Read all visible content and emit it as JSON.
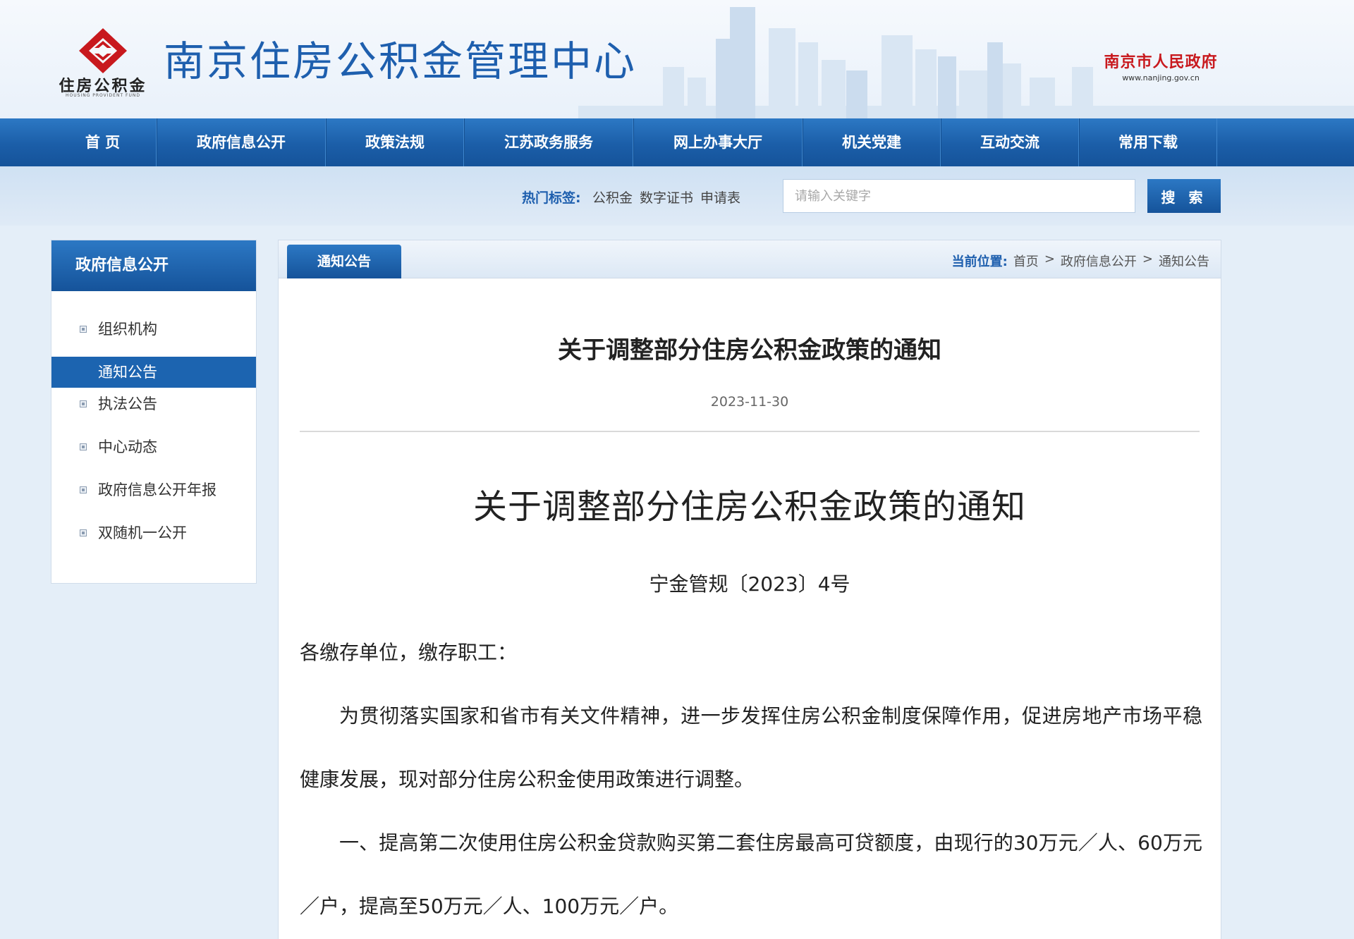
{
  "header": {
    "logo_cn": "住房公积金",
    "logo_en": "HOUSING PROVIDENT FUND",
    "site_title": "南京住房公积金管理中心",
    "gov_cn": "南京市人民政府",
    "gov_en": "www.nanjing.gov.cn",
    "colors": {
      "brand_blue": "#1e5fae",
      "logo_red": "#c8191e"
    }
  },
  "nav": {
    "items": [
      {
        "label": "首 页"
      },
      {
        "label": "政府信息公开"
      },
      {
        "label": "政策法规"
      },
      {
        "label": "江苏政务服务"
      },
      {
        "label": "网上办事大厅"
      },
      {
        "label": "机关党建"
      },
      {
        "label": "互动交流"
      },
      {
        "label": "常用下载"
      }
    ]
  },
  "search": {
    "hot_label": "热门标签:",
    "tags": [
      "公积金",
      "数字证书",
      "申请表"
    ],
    "placeholder": "请输入关键字",
    "button": "搜 索"
  },
  "sidebar": {
    "title": "政府信息公开",
    "items": [
      {
        "label": "组织机构"
      },
      {
        "label": "通知公告"
      },
      {
        "label": "执法公告"
      },
      {
        "label": "中心动态"
      },
      {
        "label": "政府信息公开年报"
      },
      {
        "label": "双随机一公开"
      }
    ],
    "active_index": 1
  },
  "main": {
    "tab": "通知公告",
    "breadcrumb": {
      "label": "当前位置:",
      "items": [
        "首页",
        "政府信息公开",
        "通知公告"
      ],
      "separator": ">"
    },
    "article": {
      "title": "关于调整部分住房公积金政策的通知",
      "date": "2023-11-30",
      "doc_title": "关于调整部分住房公积金政策的通知",
      "doc_number": "宁金管规〔2023〕4号",
      "salutation": "各缴存单位，缴存职工：",
      "paragraph_1": "为贯彻落实国家和省市有关文件精神，进一步发挥住房公积金制度保障作用，促进房地产市场平稳健康发展，现对部分住房公积金使用政策进行调整。",
      "paragraph_2": "一、提高第二次使用住房公积金贷款购买第二套住房最高可贷额度，由现行的30万元／人、60万元／户，提高至50万元／人、100万元／户。"
    }
  }
}
